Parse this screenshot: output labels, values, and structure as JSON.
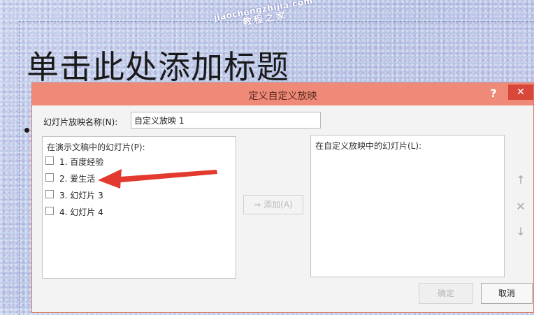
{
  "slide": {
    "title_placeholder": "单击此处添加标题"
  },
  "watermark": {
    "url": "jiaochengzhijia.com",
    "name": "教程之家"
  },
  "dialog": {
    "title": "定义自定义放映",
    "help_label": "?",
    "close_label": "✕",
    "name_label": "幻灯片放映名称(N):",
    "name_value": "自定义放映 1",
    "left_list": {
      "header": "在演示文稿中的幻灯片(P):",
      "items": [
        {
          "label": "1. 百度经验",
          "checked": false
        },
        {
          "label": "2. 爱生活",
          "checked": false
        },
        {
          "label": "3. 幻灯片 3",
          "checked": false
        },
        {
          "label": "4. 幻灯片 4",
          "checked": false
        }
      ]
    },
    "add_button": "⇒ 添加(A)",
    "right_list": {
      "header": "在自定义放映中的幻灯片(L):"
    },
    "side_buttons": {
      "up": "↑",
      "remove": "✕",
      "down": "↓"
    },
    "ok_button": "确定",
    "cancel_button": "取消"
  },
  "colors": {
    "titlebar": "#ef8a78",
    "close": "#d9463a",
    "arrow": "#e23a2e"
  }
}
